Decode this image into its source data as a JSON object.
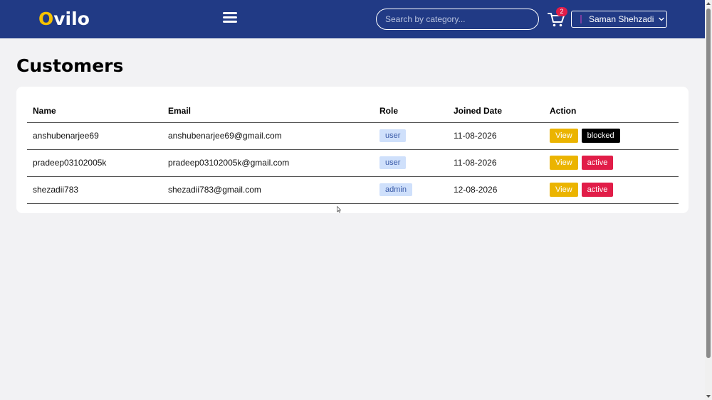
{
  "navbar": {
    "logo_first": "O",
    "logo_rest": "vilo",
    "search_placeholder": "Search by category...",
    "cart_count": "2",
    "user_name": "Saman Shehzadi"
  },
  "page": {
    "title": "Customers"
  },
  "table": {
    "headers": {
      "name": "Name",
      "email": "Email",
      "role": "Role",
      "joined": "Joined Date",
      "action": "Action"
    },
    "rows": [
      {
        "name": "anshubenarjee69",
        "email": "anshubenarjee69@gmail.com",
        "role": "user",
        "joined": "11-08-2026",
        "view": "View",
        "status": "blocked",
        "status_color": "#000000"
      },
      {
        "name": "pradeep03102005k",
        "email": "pradeep03102005k@gmail.com",
        "role": "user",
        "joined": "11-08-2026",
        "view": "View",
        "status": "active",
        "status_color": "#e11d48"
      },
      {
        "name": "shezadii783",
        "email": "shezadii783@gmail.com",
        "role": "admin",
        "joined": "12-08-2026",
        "view": "View",
        "status": "active",
        "status_color": "#e11d48"
      }
    ]
  },
  "colors": {
    "navbar": "#213a85",
    "logo_accent": "#f5c100",
    "view_button": "#ebb400",
    "active_button": "#e11d48",
    "blocked_button": "#000000",
    "role_badge": "#cfe0fb"
  }
}
